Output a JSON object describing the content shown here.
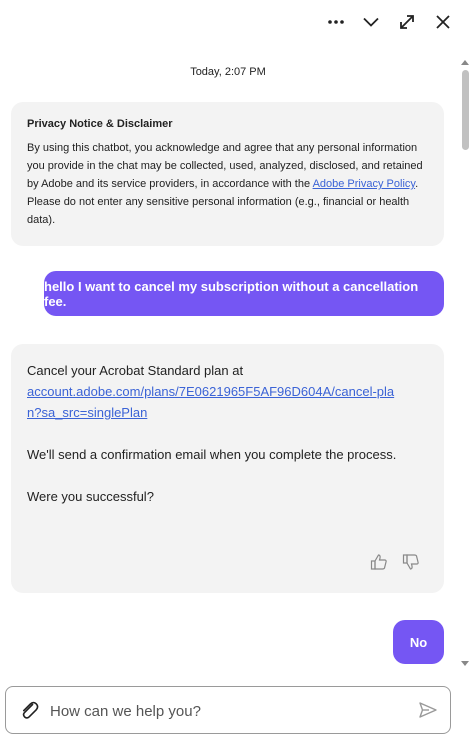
{
  "header": {
    "more_icon": "ellipsis-icon",
    "collapse_icon": "chevron-down-icon",
    "expand_icon": "expand-icon",
    "close_icon": "close-icon"
  },
  "chat": {
    "timestamp": "Today, 2:07 PM",
    "privacy": {
      "title": "Privacy Notice & Disclaimer",
      "body_before_link": "By using this chatbot, you acknowledge and agree that any personal information you provide in the chat may be collected, used, analyzed, disclosed, and retained by Adobe and its service providers, in accordance with the ",
      "link_text": "Adobe Privacy Policy",
      "body_after_link": ". Please do not enter any sensitive personal information (e.g., financial or health data)."
    },
    "user_message_1": "hello I want to cancel my subscription without a cancellation fee.",
    "reply": {
      "line1": "Cancel your Acrobat Standard plan at",
      "link": "account.adobe.com/plans/7E0621965F5AF96D604A/cancel-plan?sa_src=singlePlan",
      "line2": "We'll send a confirmation email when you complete the process.",
      "line3": "Were you successful?"
    },
    "user_message_2": "No"
  },
  "input": {
    "placeholder": "How can we help you?"
  },
  "colors": {
    "accent": "#7556f3",
    "bubble_bg": "#f3f3f3",
    "link": "#3b63d6"
  }
}
